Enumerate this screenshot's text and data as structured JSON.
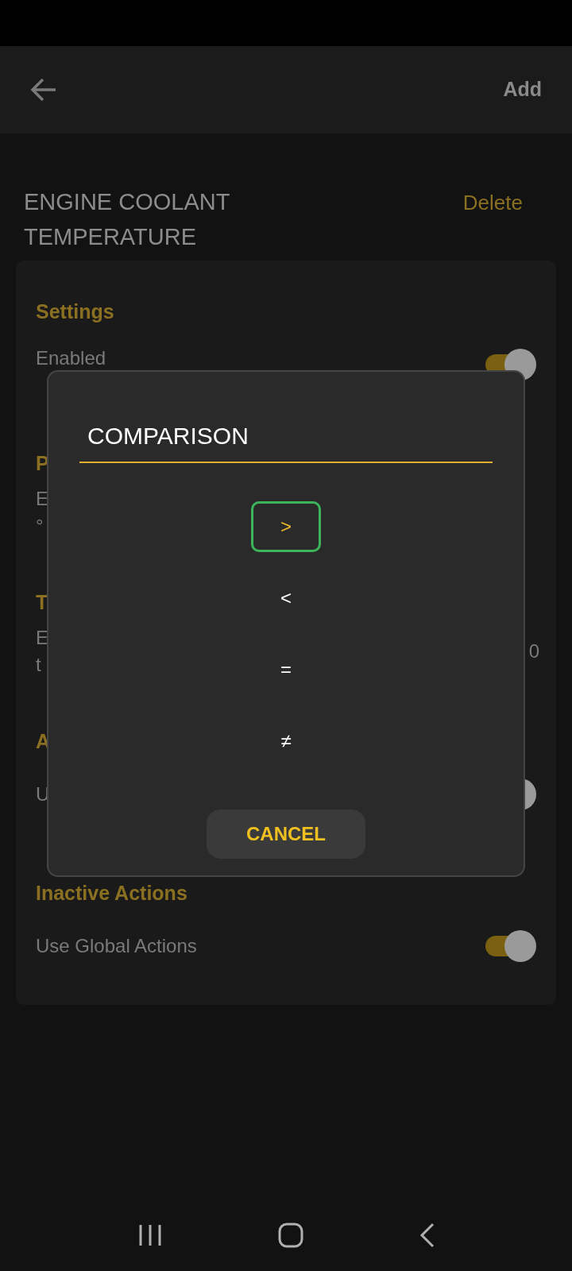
{
  "app_bar": {
    "action": "Add"
  },
  "header": {
    "title": "ENGINE COOLANT TEMPERATURE",
    "delete": "Delete"
  },
  "sections": [
    {
      "heading": "Settings",
      "rows": [
        {
          "kind": "toggle",
          "label": "Enabled",
          "on": true
        }
      ]
    },
    {
      "heading": "P",
      "rows": [
        {
          "kind": "text",
          "lines": [
            "E",
            "°"
          ]
        }
      ]
    },
    {
      "heading": "T",
      "rows": [
        {
          "kind": "text",
          "lines": [
            "E",
            "t"
          ],
          "trailing": "0"
        }
      ]
    },
    {
      "heading": "A",
      "rows": [
        {
          "kind": "toggle",
          "label": "U",
          "on": true
        }
      ]
    },
    {
      "heading": "Inactive Actions",
      "rows": [
        {
          "kind": "toggle",
          "label": "Use Global Actions",
          "on": true
        }
      ]
    }
  ],
  "dialog": {
    "title": "COMPARISON",
    "options": [
      {
        "label": ">",
        "selected": true
      },
      {
        "label": "<",
        "selected": false
      },
      {
        "label": "=",
        "selected": false
      },
      {
        "label": "≠",
        "selected": false
      }
    ],
    "cancel": "CANCEL"
  }
}
